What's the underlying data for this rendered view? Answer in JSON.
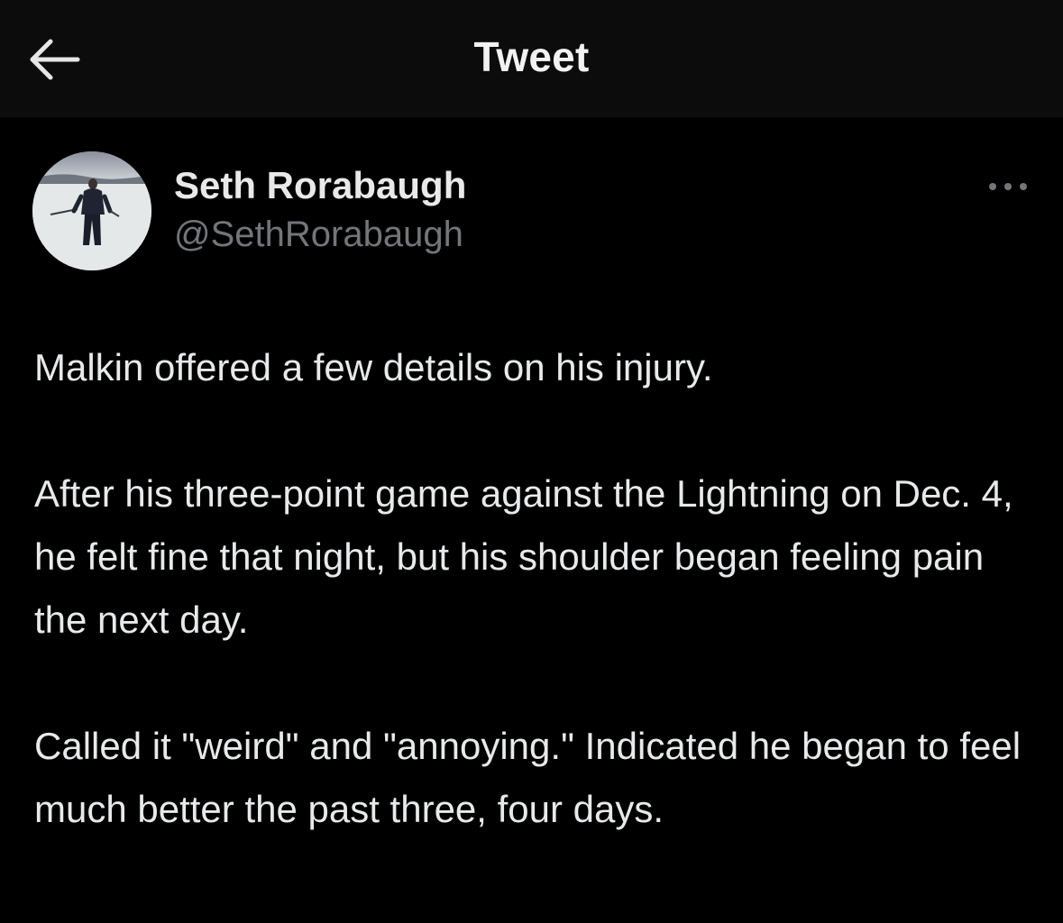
{
  "header": {
    "title": "Tweet",
    "back_icon": "arrow-left-icon"
  },
  "tweet": {
    "author": {
      "name": "Seth Rorabaugh",
      "handle": "@SethRorabaugh",
      "avatar": "avatar-photo"
    },
    "more_icon": "ellipsis-icon",
    "paragraphs": [
      "Malkin offered a few details on his injury.",
      "After his three-point game against the Lightning on Dec. 4, he felt fine that night, but his shoulder began feeling pain the next day.",
      "Called it \"weird\" and \"annoying.\" Indicated he began to feel much better the past three, four days."
    ]
  },
  "colors": {
    "background": "#000000",
    "header_background": "#0c0c0c",
    "text_primary": "#e7e9ea",
    "text_secondary": "#71767b"
  }
}
